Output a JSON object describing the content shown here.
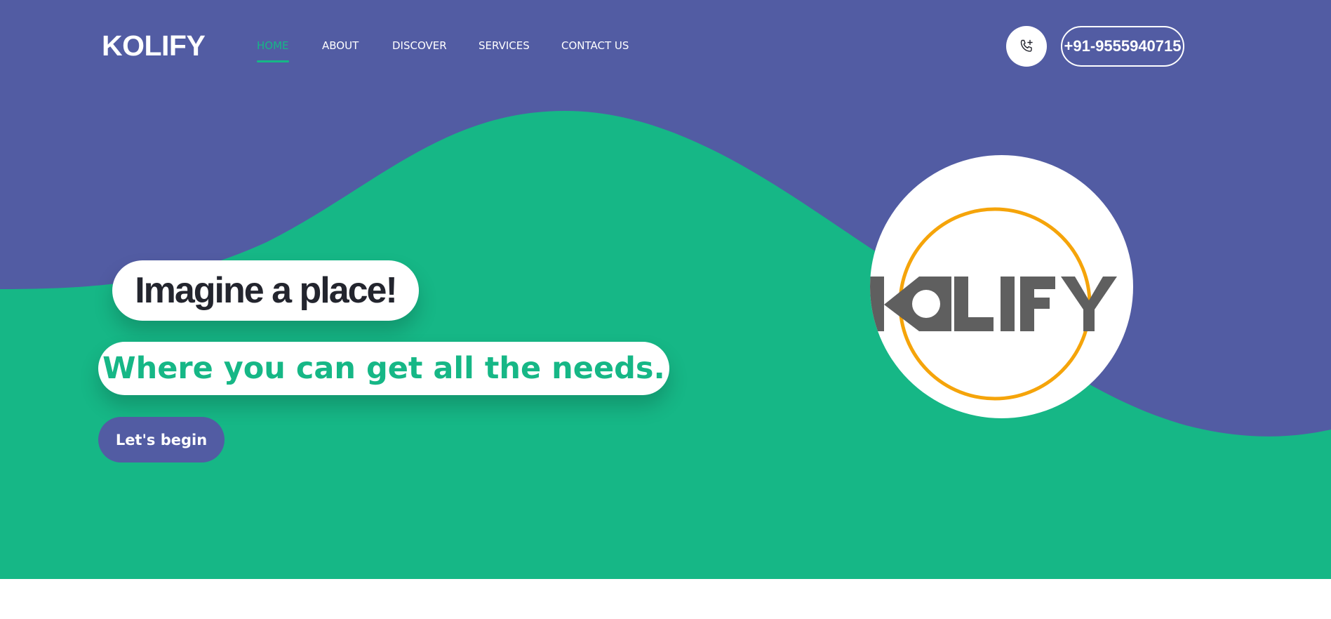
{
  "colors": {
    "primary": "#525ca3",
    "accent": "#16b786",
    "dark_text": "#23252e",
    "logo_ring": "#f5a40a",
    "logo_gray": "#5f5f5f"
  },
  "header": {
    "brand": "KOLIFY",
    "nav": [
      {
        "label": "HOME",
        "active": true
      },
      {
        "label": "ABOUT",
        "active": false
      },
      {
        "label": "DISCOVER",
        "active": false
      },
      {
        "label": "SERVICES",
        "active": false
      },
      {
        "label": "CONTACT US",
        "active": false
      }
    ],
    "phone_icon": "phone-plus-icon",
    "phone_number": "+91-9555940715"
  },
  "hero": {
    "headline": "Imagine a place!",
    "subheadline": "Where you can get all the needs.",
    "cta_label": "Let's begin",
    "logo_text": "KOLIFY"
  }
}
